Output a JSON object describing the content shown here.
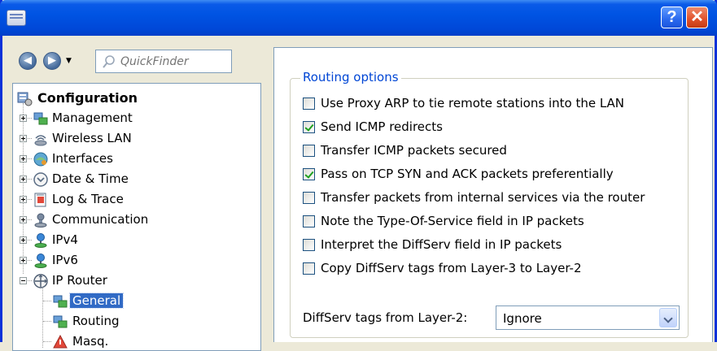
{
  "titlebar": {
    "help_label": "?",
    "close_label": "✕"
  },
  "toolbar": {
    "back_icon": "back-arrow-icon",
    "forward_icon": "forward-arrow-icon",
    "dropdown_glyph": "▼",
    "quickfinder_placeholder": "QuickFinder"
  },
  "tree": {
    "root": {
      "label": "Configuration",
      "icon": "configuration-icon"
    },
    "items": [
      {
        "label": "Management",
        "icon": "management-icon",
        "expander": "+"
      },
      {
        "label": "Wireless LAN",
        "icon": "wireless-lan-icon",
        "expander": "+"
      },
      {
        "label": "Interfaces",
        "icon": "interfaces-icon",
        "expander": "+"
      },
      {
        "label": "Date & Time",
        "icon": "clock-icon",
        "expander": "+"
      },
      {
        "label": "Log & Trace",
        "icon": "log-trace-icon",
        "expander": "+"
      },
      {
        "label": "Communication",
        "icon": "communication-icon",
        "expander": "+"
      },
      {
        "label": "IPv4",
        "icon": "ipv4-icon",
        "expander": "+"
      },
      {
        "label": "IPv6",
        "icon": "ipv6-icon",
        "expander": "+"
      },
      {
        "label": "IP Router",
        "icon": "ip-router-icon",
        "expander": "-"
      }
    ],
    "children": [
      {
        "label": "General",
        "icon": "general-icon",
        "selected": true
      },
      {
        "label": "Routing",
        "icon": "routing-icon",
        "selected": false
      },
      {
        "label": "Masq.",
        "icon": "masq-warning-icon",
        "selected": false
      }
    ]
  },
  "routing_options": {
    "title": "Routing options",
    "options": [
      {
        "label": "Use Proxy ARP to tie remote stations into the LAN",
        "checked": false
      },
      {
        "label": "Send ICMP redirects",
        "checked": true
      },
      {
        "label": "Transfer ICMP packets secured",
        "checked": false
      },
      {
        "label": "Pass on TCP SYN and ACK packets preferentially",
        "checked": true
      },
      {
        "label": "Transfer packets from internal services via the router",
        "checked": false
      },
      {
        "label": "Note the Type-Of-Service field in IP packets",
        "checked": false
      },
      {
        "label": "Interpret the DiffServ field in IP packets",
        "checked": false
      },
      {
        "label": "Copy DiffServ tags from Layer-3 to Layer-2",
        "checked": false
      }
    ],
    "diffserv_select": {
      "label": "DiffServ tags from Layer-2:",
      "value": "Ignore"
    }
  },
  "colors": {
    "titlebar": "#0054e3",
    "selection": "#316ac5",
    "group_title": "#0046d5",
    "check": "#21a121"
  }
}
